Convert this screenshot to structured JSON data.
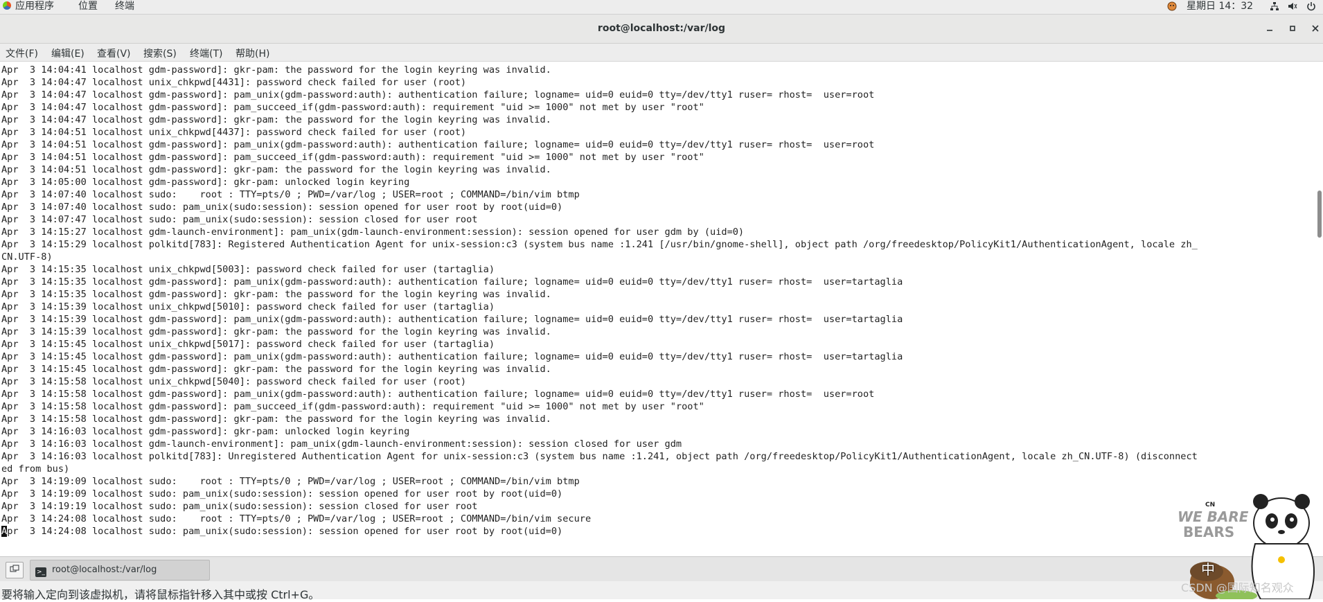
{
  "topbar": {
    "apps_label": "应用程序",
    "places_label": "位置",
    "terminal_label": "终端",
    "clock": "星期日 14：32"
  },
  "window": {
    "title": "root@localhost:/var/log"
  },
  "menubar": {
    "items": [
      "文件(F)",
      "编辑(E)",
      "查看(V)",
      "搜索(S)",
      "终端(T)",
      "帮助(H)"
    ]
  },
  "terminal": {
    "lines": [
      "Apr  3 14:04:41 localhost gdm-password]: gkr-pam: the password for the login keyring was invalid.",
      "Apr  3 14:04:47 localhost unix_chkpwd[4431]: password check failed for user (root)",
      "Apr  3 14:04:47 localhost gdm-password]: pam_unix(gdm-password:auth): authentication failure; logname= uid=0 euid=0 tty=/dev/tty1 ruser= rhost=  user=root",
      "Apr  3 14:04:47 localhost gdm-password]: pam_succeed_if(gdm-password:auth): requirement \"uid >= 1000\" not met by user \"root\"",
      "Apr  3 14:04:47 localhost gdm-password]: gkr-pam: the password for the login keyring was invalid.",
      "Apr  3 14:04:51 localhost unix_chkpwd[4437]: password check failed for user (root)",
      "Apr  3 14:04:51 localhost gdm-password]: pam_unix(gdm-password:auth): authentication failure; logname= uid=0 euid=0 tty=/dev/tty1 ruser= rhost=  user=root",
      "Apr  3 14:04:51 localhost gdm-password]: pam_succeed_if(gdm-password:auth): requirement \"uid >= 1000\" not met by user \"root\"",
      "Apr  3 14:04:51 localhost gdm-password]: gkr-pam: the password for the login keyring was invalid.",
      "Apr  3 14:05:00 localhost gdm-password]: gkr-pam: unlocked login keyring",
      "Apr  3 14:07:40 localhost sudo:    root : TTY=pts/0 ; PWD=/var/log ; USER=root ; COMMAND=/bin/vim btmp",
      "Apr  3 14:07:40 localhost sudo: pam_unix(sudo:session): session opened for user root by root(uid=0)",
      "Apr  3 14:07:47 localhost sudo: pam_unix(sudo:session): session closed for user root",
      "Apr  3 14:15:27 localhost gdm-launch-environment]: pam_unix(gdm-launch-environment:session): session opened for user gdm by (uid=0)",
      "Apr  3 14:15:29 localhost polkitd[783]: Registered Authentication Agent for unix-session:c3 (system bus name :1.241 [/usr/bin/gnome-shell], object path /org/freedesktop/PolicyKit1/AuthenticationAgent, locale zh_",
      "CN.UTF-8)",
      "Apr  3 14:15:35 localhost unix_chkpwd[5003]: password check failed for user (tartaglia)",
      "Apr  3 14:15:35 localhost gdm-password]: pam_unix(gdm-password:auth): authentication failure; logname= uid=0 euid=0 tty=/dev/tty1 ruser= rhost=  user=tartaglia",
      "Apr  3 14:15:35 localhost gdm-password]: gkr-pam: the password for the login keyring was invalid.",
      "Apr  3 14:15:39 localhost unix_chkpwd[5010]: password check failed for user (tartaglia)",
      "Apr  3 14:15:39 localhost gdm-password]: pam_unix(gdm-password:auth): authentication failure; logname= uid=0 euid=0 tty=/dev/tty1 ruser= rhost=  user=tartaglia",
      "Apr  3 14:15:39 localhost gdm-password]: gkr-pam: the password for the login keyring was invalid.",
      "Apr  3 14:15:45 localhost unix_chkpwd[5017]: password check failed for user (tartaglia)",
      "Apr  3 14:15:45 localhost gdm-password]: pam_unix(gdm-password:auth): authentication failure; logname= uid=0 euid=0 tty=/dev/tty1 ruser= rhost=  user=tartaglia",
      "Apr  3 14:15:45 localhost gdm-password]: gkr-pam: the password for the login keyring was invalid.",
      "Apr  3 14:15:58 localhost unix_chkpwd[5040]: password check failed for user (root)",
      "Apr  3 14:15:58 localhost gdm-password]: pam_unix(gdm-password:auth): authentication failure; logname= uid=0 euid=0 tty=/dev/tty1 ruser= rhost=  user=root",
      "Apr  3 14:15:58 localhost gdm-password]: pam_succeed_if(gdm-password:auth): requirement \"uid >= 1000\" not met by user \"root\"",
      "Apr  3 14:15:58 localhost gdm-password]: gkr-pam: the password for the login keyring was invalid.",
      "Apr  3 14:16:03 localhost gdm-password]: gkr-pam: unlocked login keyring",
      "Apr  3 14:16:03 localhost gdm-launch-environment]: pam_unix(gdm-launch-environment:session): session closed for user gdm",
      "Apr  3 14:16:03 localhost polkitd[783]: Unregistered Authentication Agent for unix-session:c3 (system bus name :1.241, object path /org/freedesktop/PolicyKit1/AuthenticationAgent, locale zh_CN.UTF-8) (disconnect",
      "ed from bus)",
      "Apr  3 14:19:09 localhost sudo:    root : TTY=pts/0 ; PWD=/var/log ; USER=root ; COMMAND=/bin/vim btmp",
      "Apr  3 14:19:09 localhost sudo: pam_unix(sudo:session): session opened for user root by root(uid=0)",
      "Apr  3 14:19:19 localhost sudo: pam_unix(sudo:session): session closed for user root",
      "Apr  3 14:24:08 localhost sudo:    root : TTY=pts/0 ; PWD=/var/log ; USER=root ; COMMAND=/bin/vim secure",
      "Apr  3 14:24:08 localhost sudo: pam_unix(sudo:session): session opened for user root by root(uid=0)"
    ]
  },
  "taskbar": {
    "task_label": "root@localhost:/var/log"
  },
  "hintbar": {
    "text": "要将输入定向到该虚拟机，请将鼠标指针移入其中或按 Ctrl+G。"
  },
  "watermark": {
    "sticker_text_1": "WE BARE",
    "sticker_text_2": "BEARS",
    "sticker_badge": "CN",
    "ime": "中",
    "csdn": "CSDN @国际知名观众"
  },
  "icons": {
    "apps": "apps-logo-icon",
    "status": [
      "user-avatar-icon",
      "network-icon",
      "volume-icon",
      "power-icon"
    ],
    "window": [
      "minimize-icon",
      "maximize-icon",
      "close-icon"
    ],
    "taskbar": [
      "show-desktop-icon",
      "terminal-app-icon"
    ]
  }
}
